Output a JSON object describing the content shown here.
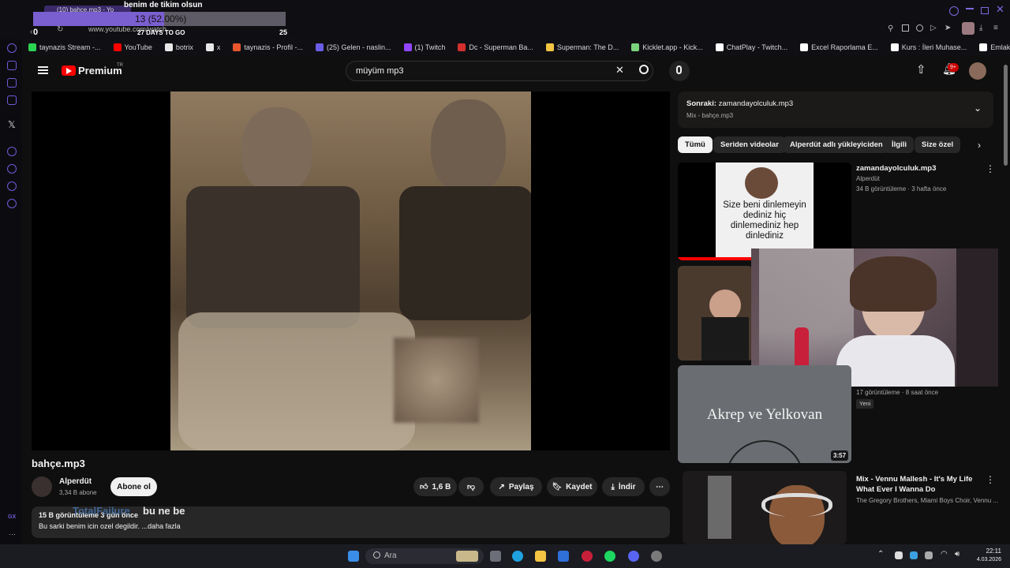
{
  "stream_overlay": {
    "goal_title": "benim de tikim olsun",
    "goal_progress_text": "13 (52.00%)",
    "goal_progress": 0.52,
    "goal_start": "0",
    "goal_end": "25",
    "days_left": "27 DAYS TO GO",
    "chat_user": "TotalFailure",
    "chat_message": "bu ne be"
  },
  "browser": {
    "tab_title": "(10) bahçe.mp3 - Yo",
    "address": "www.youtube.com/watch",
    "bookmarks": [
      {
        "label": "taynazis Stream -...",
        "color": "#2bd453"
      },
      {
        "label": "YouTube",
        "color": "#ff0000"
      },
      {
        "label": "botrix",
        "color": "#e8e8e8"
      },
      {
        "label": "x",
        "color": "#e8e8e8"
      },
      {
        "label": "taynazis - Profil -...",
        "color": "#e8572d"
      },
      {
        "label": "(25) Gelen - naslin...",
        "color": "#6c5ce7"
      },
      {
        "label": "(1) Twitch",
        "color": "#9146ff"
      },
      {
        "label": "Dc - Superman Ba...",
        "color": "#d32f2f"
      },
      {
        "label": "Superman: The D...",
        "color": "#f4c542"
      },
      {
        "label": "Kicklet.app - Kick...",
        "color": "#7bd37b"
      },
      {
        "label": "ChatPlay - Twitch...",
        "color": "#ffffff"
      },
      {
        "label": "Excel Raporlama E...",
        "color": "#ffffff"
      },
      {
        "label": "Kurs : İleri Muhase...",
        "color": "#ffffff"
      },
      {
        "label": "Emlak Danışmanlı...",
        "color": "#ffffff"
      }
    ]
  },
  "youtube": {
    "logo_text": "Premium",
    "logo_region": "TR",
    "search_value": "müyüm mp3",
    "notification_count": "9+",
    "video_title": "bahçe.mp3",
    "channel_name": "Alperdüt",
    "subscribers": "3,34 B abone",
    "subscribe_label": "Abone ol",
    "like_count": "1,6 B",
    "share_label": "Paylaş",
    "save_label": "Kaydet",
    "download_label": "İndir",
    "views_meta": "15 B görüntüleme  3 gün önce",
    "description": "Bu sarki benim icin ozel degildir. ...daha fazla",
    "up_next_prefix": "Sonraki:",
    "up_next_title": "zamandayolculuk.mp3",
    "up_next_mix": "Mix - bahçe.mp3",
    "chips": [
      "Tümü",
      "Seriden videolar",
      "Alperdüt adlı yükleyiciden",
      "İlgili",
      "Size özel"
    ],
    "recommendations": [
      {
        "title": "zamandayolculuk.mp3",
        "channel": "Alperdüt",
        "meta": "34 B görüntüleme · 3 hafta önce",
        "thumb_text": "Size beni dinlemeyin dediniz hiç dinlemediniz hep dinlediniz"
      },
      {
        "meta": "17 görüntüleme · 8 saat önce",
        "badge": "Yeni",
        "thumb_text": "Akrep ve Yelkovan",
        "duration": "3:57"
      },
      {
        "title": "Mix - Vennu Mallesh - It's My Life What Ever I Wanna Do",
        "channel": "The Gregory Brothers, Miami Boys Choir, Vennu ..."
      }
    ]
  },
  "taskbar": {
    "search_placeholder": "Ara",
    "time": "22:11",
    "date": "4.03.2026"
  }
}
